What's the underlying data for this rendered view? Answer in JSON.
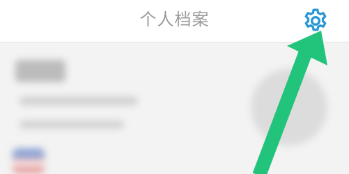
{
  "header": {
    "title": "个人档案",
    "settings_icon": "gear-icon"
  },
  "colors": {
    "gear": "#2b98d6",
    "arrow": "#22c37a",
    "title": "#9b9b9b"
  }
}
